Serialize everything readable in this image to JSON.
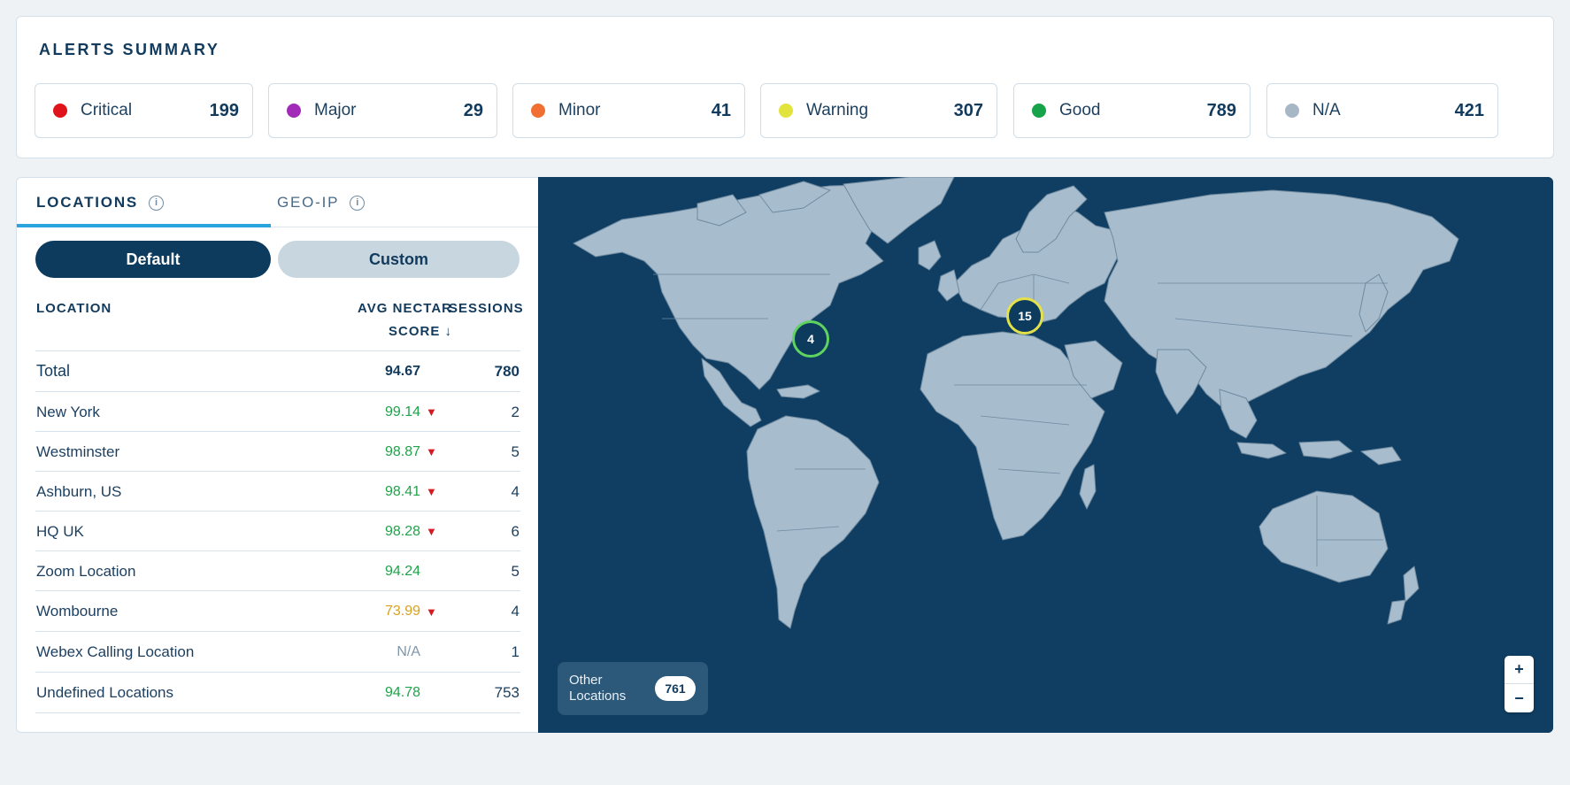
{
  "alerts": {
    "title": "ALERTS SUMMARY",
    "items": [
      {
        "label": "Critical",
        "count": "199",
        "color": "#e0121b"
      },
      {
        "label": "Major",
        "count": "29",
        "color": "#a12bb8"
      },
      {
        "label": "Minor",
        "count": "41",
        "color": "#f26f33"
      },
      {
        "label": "Warning",
        "count": "307",
        "color": "#e3e33d"
      },
      {
        "label": "Good",
        "count": "789",
        "color": "#16a34a"
      },
      {
        "label": "N/A",
        "count": "421",
        "color": "#a8b7c5"
      }
    ]
  },
  "tabs": {
    "locations": "LOCATIONS",
    "geoip": "GEO-IP",
    "info_icon": "i"
  },
  "segment": {
    "default": "Default",
    "custom": "Custom"
  },
  "table": {
    "headers": {
      "location": "LOCATION",
      "score_line1": "AVG NECTAR",
      "score_line2": "SCORE ↓",
      "sessions": "SESSIONS"
    },
    "total": {
      "name": "Total",
      "score": "94.67",
      "sessions": "780"
    },
    "rows": [
      {
        "name": "New York",
        "score": "99.14",
        "trend": "▼",
        "sessions": "2",
        "score_color": "#1fa34a"
      },
      {
        "name": "Westminster",
        "score": "98.87",
        "trend": "▼",
        "sessions": "5",
        "score_color": "#1fa34a"
      },
      {
        "name": "Ashburn, US",
        "score": "98.41",
        "trend": "▼",
        "sessions": "4",
        "score_color": "#1fa34a"
      },
      {
        "name": "HQ UK",
        "score": "98.28",
        "trend": "▼",
        "sessions": "6",
        "score_color": "#1fa34a"
      },
      {
        "name": "Zoom Location",
        "score": "94.24",
        "trend": "",
        "sessions": "5",
        "score_color": "#1fa34a"
      },
      {
        "name": "Wombourne",
        "score": "73.99",
        "trend": "▼",
        "sessions": "4",
        "score_color": "#d9a21e"
      },
      {
        "name": "Webex Calling Location",
        "score": "N/A",
        "trend": "",
        "sessions": "1",
        "score_color": "#7f96aa"
      },
      {
        "name": "Undefined Locations",
        "score": "94.78",
        "trend": "",
        "sessions": "753",
        "score_color": "#1fa34a"
      }
    ]
  },
  "map": {
    "clusters": [
      {
        "count": "4",
        "ring_color": "#5fd35f"
      },
      {
        "count": "15",
        "ring_color": "#e4e14a"
      }
    ],
    "other_locations_label_line1": "Other",
    "other_locations_label_line2": "Locations",
    "other_locations_count": "761",
    "zoom_in": "+",
    "zoom_out": "−",
    "land_color": "#a7bccd",
    "sea_color": "#0f3e62"
  }
}
